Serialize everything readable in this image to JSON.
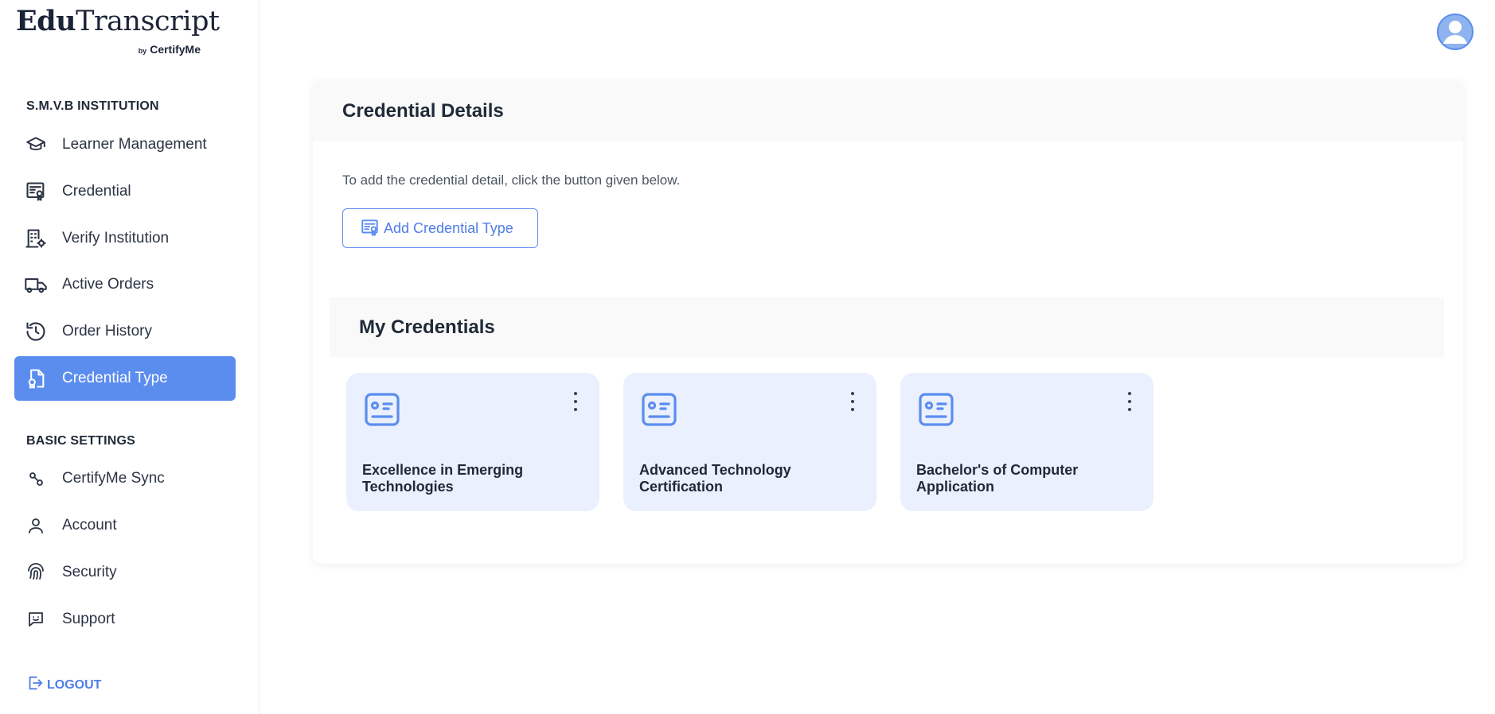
{
  "brand": {
    "logo_bold": "Edu",
    "logo_rest": "Transcript",
    "by": "by",
    "sub": "CertifyMe"
  },
  "sidebar": {
    "institution_title": "S.M.V.B INSTITUTION",
    "items": [
      {
        "label": "Learner Management",
        "icon": "graduation-cap-icon"
      },
      {
        "label": "Credential",
        "icon": "certificate-icon"
      },
      {
        "label": "Verify Institution",
        "icon": "building-gear-icon"
      },
      {
        "label": "Active Orders",
        "icon": "delivery-truck-icon"
      },
      {
        "label": "Order History",
        "icon": "history-icon"
      },
      {
        "label": "Credential Type",
        "icon": "file-badge-icon",
        "active": true
      }
    ],
    "settings_title": "BASIC SETTINGS",
    "settings_items": [
      {
        "label": "CertifyMe Sync",
        "icon": "sync-icon"
      },
      {
        "label": "Account",
        "icon": "user-icon"
      },
      {
        "label": "Security",
        "icon": "fingerprint-icon"
      },
      {
        "label": "Support",
        "icon": "chat-smile-icon"
      }
    ],
    "logout_label": "LOGOUT"
  },
  "header": {
    "avatar_icon": "user-avatar-icon"
  },
  "main": {
    "title": "Credential Details",
    "description": "To add the credential detail, click the button given below.",
    "add_button_label": "Add Credential Type",
    "section_title": "My Credentials",
    "credentials": [
      {
        "name": "Excellence in Emerging Technologies"
      },
      {
        "name": "Advanced Technology Certification"
      },
      {
        "name": "Bachelor's of Computer Application"
      }
    ]
  },
  "colors": {
    "accent": "#5b8def",
    "card_bg": "#eaf0fd",
    "header_bg": "#f9f9f9"
  }
}
